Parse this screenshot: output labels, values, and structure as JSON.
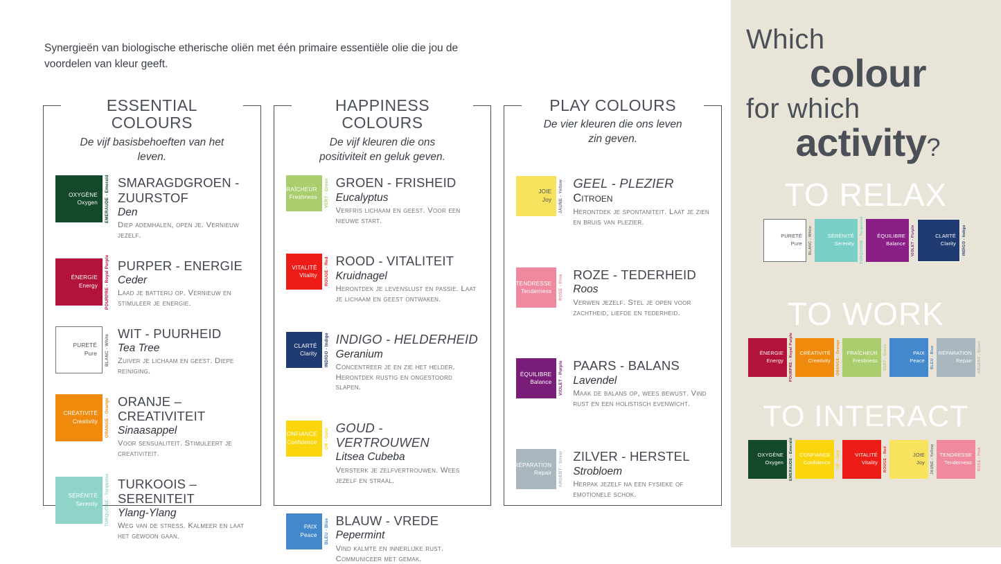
{
  "intro": "Synergieën van biologische etherische oliën met één primaire essentiële olie die jou de voordelen van kleur geeft.",
  "columns": [
    {
      "key": "essential",
      "title": "ESSENTIAL COLOURS",
      "subtitle": "De vijf basisbehoeften van het leven.",
      "entries": [
        {
          "title": "SMARAGDGROEN - ZUURSTOF",
          "title_italic": false,
          "oil": "Den",
          "oil_smallcaps": false,
          "desc": "Diep ademhalen, open je. Vernieuw jezelf.",
          "swatch_fr": "OXYGÈNE",
          "swatch_en": "Oxygen",
          "vertical": "EMERAUDE - Emerald",
          "bg": "#14482a",
          "text_color": "#ffffff",
          "vert_color": "#14482a",
          "border": "none"
        },
        {
          "title": "PURPER - ENERGIE",
          "title_italic": false,
          "oil": "Ceder",
          "oil_smallcaps": false,
          "desc": "Laad je batterij op. Vernieuw en stimuleer je energie.",
          "swatch_fr": "ÉNERGIE",
          "swatch_en": "Energy",
          "vertical": "POURPRE - Royal Purple",
          "bg": "#b3123a",
          "text_color": "#ffffff",
          "vert_color": "#b3123a",
          "border": "none"
        },
        {
          "title": "WIT - PUURHEID",
          "title_italic": false,
          "oil": "Tea Tree",
          "oil_smallcaps": false,
          "desc": "Zuiver je lichaam en geest. Diepe reiniging.",
          "swatch_fr": "PURETÉ",
          "swatch_en": "Pure",
          "vertical": "BLANC - White",
          "bg": "#ffffff",
          "text_color": "#4a4f57",
          "vert_color": "#6d7277",
          "border": "1.5px solid #6d7277"
        },
        {
          "title": "ORANJE – CREATIVITEIT",
          "title_italic": false,
          "oil": "Sinaasappel",
          "oil_smallcaps": false,
          "desc": "Voor sensualiteit. Stimuleert je creativiteit.",
          "swatch_fr": "CRÉATIVITÉ",
          "swatch_en": "Creativity",
          "vertical": "ORANGE - Orange",
          "bg": "#f08a0c",
          "text_color": "#ffffff",
          "vert_color": "#f08a0c",
          "border": "none"
        },
        {
          "title": "TURKOOIS – SERENITEIT",
          "title_italic": false,
          "oil": "Ylang-Ylang",
          "oil_smallcaps": false,
          "desc": "Weg van de stress. Kalmeer en laat het gewoon gaan.",
          "swatch_fr": "SÉRÉNITÉ",
          "swatch_en": "Serenity",
          "vertical": "TURQUOISE - Turquoise",
          "bg": "#8ed4c8",
          "text_color": "#ffffff",
          "vert_color": "#8ed4c8",
          "border": "none"
        }
      ]
    },
    {
      "key": "happiness",
      "title": "HAPPINESS COLOURS",
      "subtitle": "De vijf kleuren die ons positiviteit en geluk geven.",
      "entries": [
        {
          "title": "GROEN - FRISHEID",
          "title_italic": false,
          "oil": "Eucalyptus",
          "oil_smallcaps": false,
          "desc": "Verfris lichaam en geest. Voor een nieuwe start.",
          "swatch_fr": "FRAÎCHEUR",
          "swatch_en": "Freshness",
          "vertical": "VERT - Green",
          "bg": "#aacd6e",
          "text_color": "#ffffff",
          "vert_color": "#aacd6e",
          "border": "none"
        },
        {
          "title": "ROOD - VITALITEIT",
          "title_italic": false,
          "oil": "Kruidnagel",
          "oil_smallcaps": false,
          "desc": "Herontdek je levenslust en passie. Laat je lichaam en geest ontwaken.",
          "swatch_fr": "VITALITÉ",
          "swatch_en": "Vitality",
          "vertical": "ROUGE - Red",
          "bg": "#ed1c16",
          "text_color": "#ffffff",
          "vert_color": "#ed1c16",
          "border": "none"
        },
        {
          "title": "INDIGO - HELDERHEID",
          "title_italic": true,
          "oil": "Geranium",
          "oil_smallcaps": false,
          "desc": "Concentreer je en zie het helder. Herontdek rustig en ongestoord slapen.",
          "swatch_fr": "CLARTÉ",
          "swatch_en": "Clarity",
          "vertical": "INDIGO - Indigo",
          "bg": "#1f3b72",
          "text_color": "#ffffff",
          "vert_color": "#1f3b72",
          "border": "none"
        },
        {
          "title": "GOUD - VERTROUWEN",
          "title_italic": true,
          "oil": "Litsea Cubeba",
          "oil_smallcaps": false,
          "desc": "Versterk je zelfvertrouwen. Wees jezelf en straal.",
          "swatch_fr": "CONFIANCE",
          "swatch_en": "Confidence",
          "vertical": "OR - Gold",
          "bg": "#fbd50b",
          "text_color": "#ffffff",
          "vert_color": "#fbd50b",
          "border": "none"
        },
        {
          "title": "BLAUW - VREDE",
          "title_italic": false,
          "oil": "Pepermint",
          "oil_smallcaps": false,
          "desc": "Vind kalmte en innerlijke rust. Communiceer met gemak.",
          "swatch_fr": "PAIX",
          "swatch_en": "Peace",
          "vertical": "BLEU - Blue",
          "bg": "#4387cd",
          "text_color": "#ffffff",
          "vert_color": "#4387cd",
          "border": "none"
        }
      ]
    },
    {
      "key": "play",
      "title": "PLAY COLOURS",
      "subtitle": "De vier kleuren die ons leven zin geven.",
      "entries": [
        {
          "title": "GEEL - PLEZIER",
          "title_italic": true,
          "oil": "Citroen",
          "oil_smallcaps": true,
          "desc": "Herontdek je spontaniteit. Laat je zien en bruis van plezier.",
          "swatch_fr": "JOIE",
          "swatch_en": "Joy",
          "vertical": "JAUNE - Yellow",
          "bg": "#f9e25e",
          "text_color": "#4a4f57",
          "vert_color": "#6d7277",
          "border": "none"
        },
        {
          "title": "ROZE - TEDERHEID",
          "title_italic": false,
          "oil": "Roos",
          "oil_smallcaps": false,
          "desc": "Verwen jezelf. Stel je open voor zachtheid, liefde en tederheid.",
          "swatch_fr": "TENDRESSE",
          "swatch_en": "Tenderness",
          "vertical": "ROSE - Pink",
          "bg": "#f0899e",
          "text_color": "#ffffff",
          "vert_color": "#f0899e",
          "border": "none"
        },
        {
          "title": "PAARS - BALANS",
          "title_italic": false,
          "oil": "Lavendel",
          "oil_smallcaps": false,
          "desc": "Maak de balans op, wees bewust. Vind rust en een holistisch evenwicht.",
          "swatch_fr": "ÉQUILIBRE",
          "swatch_en": "Balance",
          "vertical": "VIOLET - Purple",
          "bg": "#7a1d79",
          "text_color": "#ffffff",
          "vert_color": "#7a1d79",
          "border": "none"
        },
        {
          "title": "ZILVER - HERSTEL",
          "title_italic": false,
          "oil": "Strobloem",
          "oil_smallcaps": false,
          "desc": "Herpak jezelf na een fysieke of emotionele schok.",
          "swatch_fr": "RÉPARATION",
          "swatch_en": "Repair",
          "vertical": "ARGENT - Silver",
          "bg": "#a9b7bf",
          "text_color": "#ffffff",
          "vert_color": "#a9b7bf",
          "border": "none"
        }
      ]
    }
  ],
  "panel": {
    "background": "#e8e5d8",
    "headline": {
      "line1": "Which",
      "line2": "colour",
      "line3": "for which",
      "line4": "activity",
      "question_mark": "?"
    },
    "activities": [
      {
        "key": "relax",
        "title": "TO RELAX",
        "swatches": [
          {
            "fr": "PURETÉ",
            "en": "Pure",
            "vertical": "BLANC - White",
            "bg": "#ffffff",
            "text_color": "#4a4f57",
            "vert_color": "#6d7277",
            "border": "1.4px solid #6d7277"
          },
          {
            "fr": "SÉRÉNITÉ",
            "en": "Serenity",
            "vertical": "TURQUOISE - Turquoise",
            "bg": "#79cfc6",
            "text_color": "#ffffff",
            "vert_color": "#79cfc6",
            "border": "none"
          },
          {
            "fr": "ÉQUILIBRE",
            "en": "Balance",
            "vertical": "VIOLET - Purple",
            "bg": "#8a1f87",
            "text_color": "#ffffff",
            "vert_color": "#8a1f87",
            "border": "none"
          },
          {
            "fr": "CLARTÉ",
            "en": "Clarity",
            "vertical": "INDIGO - Indigo",
            "bg": "#1f3b72",
            "text_color": "#ffffff",
            "vert_color": "#1f3b72",
            "border": "1.4px solid #ffffff"
          }
        ]
      },
      {
        "key": "work",
        "title": "TO WORK",
        "swatches": [
          {
            "fr": "ÉNERGIE",
            "en": "Energy",
            "vertical": "POURPRE - Royal Purple",
            "bg": "#b3123a",
            "text_color": "#ffffff",
            "vert_color": "#b3123a",
            "border": "none"
          },
          {
            "fr": "CRÉATIVITÉ",
            "en": "Creativity",
            "vertical": "ORANGE - Orange",
            "bg": "#f08a0c",
            "text_color": "#ffffff",
            "vert_color": "#f08a0c",
            "border": "none"
          },
          {
            "fr": "FRAÎCHEUR",
            "en": "Freshness",
            "vertical": "VERT - Green",
            "bg": "#aacd6e",
            "text_color": "#ffffff",
            "vert_color": "#aacd6e",
            "border": "none"
          },
          {
            "fr": "PAIX",
            "en": "Peace",
            "vertical": "BLEU - Blue",
            "bg": "#4387cd",
            "text_color": "#ffffff",
            "vert_color": "#4387cd",
            "border": "none"
          },
          {
            "fr": "RÉPARATION",
            "en": "Repair",
            "vertical": "ARGENT - Silver",
            "bg": "#a9b7bf",
            "text_color": "#ffffff",
            "vert_color": "#a9b7bf",
            "border": "none"
          }
        ]
      },
      {
        "key": "interact",
        "title": "TO INTERACT",
        "swatches": [
          {
            "fr": "OXYGÈNE",
            "en": "Oxygen",
            "vertical": "EMERAUDE - Emerald",
            "bg": "#14482a",
            "text_color": "#ffffff",
            "vert_color": "#14482a",
            "border": "none"
          },
          {
            "fr": "CONFIANCE",
            "en": "Confidence",
            "vertical": "OR - Gold",
            "bg": "#fbd50b",
            "text_color": "#ffffff",
            "vert_color": "#fbd50b",
            "border": "none"
          },
          {
            "fr": "VITALITÉ",
            "en": "Vitality",
            "vertical": "ROUGE - Red",
            "bg": "#ed1c16",
            "text_color": "#ffffff",
            "vert_color": "#ed1c16",
            "border": "none"
          },
          {
            "fr": "JOIE",
            "en": "Joy",
            "vertical": "JAUNE - Yellow",
            "bg": "#f9e25e",
            "text_color": "#4a4f57",
            "vert_color": "#6d7277",
            "border": "none"
          },
          {
            "fr": "TENDRESSE",
            "en": "Tenderness",
            "vertical": "ROSE - Pink",
            "bg": "#f0899e",
            "text_color": "#ffffff",
            "vert_color": "#f0899e",
            "border": "none"
          }
        ]
      }
    ]
  }
}
